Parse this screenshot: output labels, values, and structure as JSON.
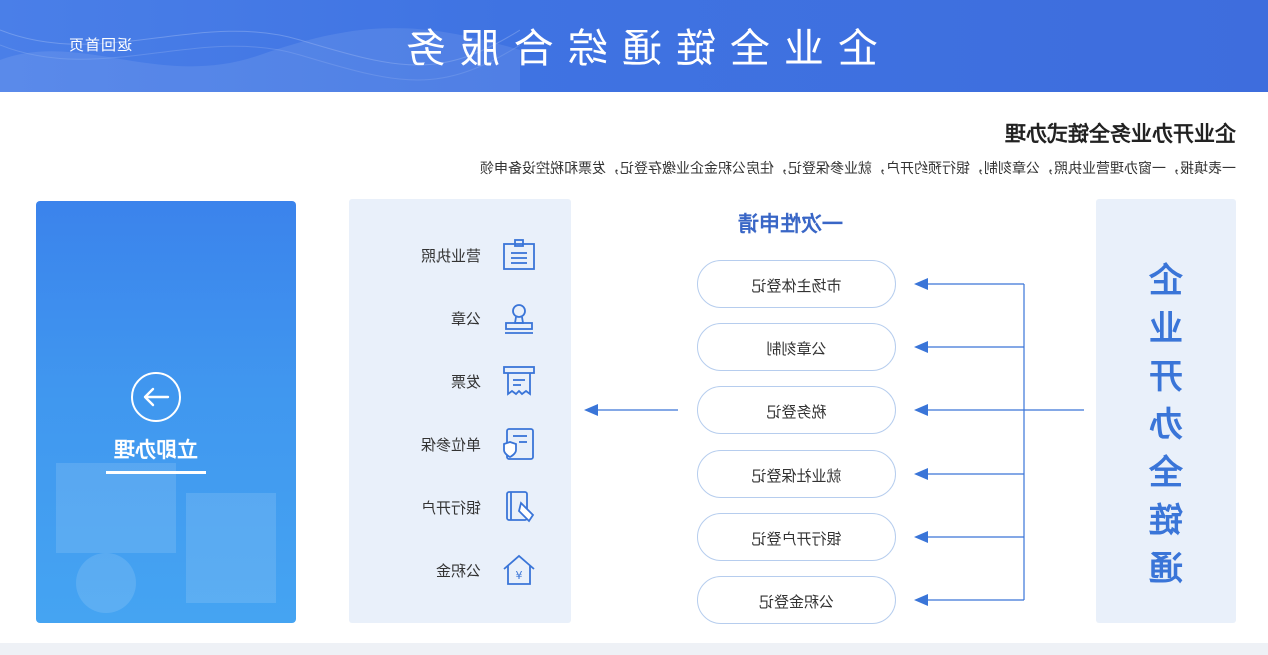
{
  "header": {
    "title": "企业全链通综合服务",
    "back_link": "返回首页"
  },
  "intro": {
    "heading": "企业开办业务全链式办理",
    "description": "一表填报，一窗办理营业执照，公章刻制，银行预约开户，就业参保登记，住房公积金企业缴存登记，发票和税控设备申领"
  },
  "action_card": {
    "label": "立即办理",
    "icon": "arrow-left-icon"
  },
  "materials": [
    {
      "label": "营业执照",
      "icon": "license-icon"
    },
    {
      "label": "公章",
      "icon": "seal-icon"
    },
    {
      "label": "发票",
      "icon": "invoice-icon"
    },
    {
      "label": "单位参保",
      "icon": "insurance-icon"
    },
    {
      "label": "银行开户",
      "icon": "bank-card-icon"
    },
    {
      "label": "公积金",
      "icon": "housing-fund-icon"
    }
  ],
  "apply": {
    "title": "一次性申请",
    "steps": [
      "市场主体登记",
      "公章刻制",
      "税务登记",
      "就业社保登记",
      "银行开户登记",
      "公积金登记"
    ]
  },
  "side_panel": {
    "chars": [
      "企",
      "业",
      "开",
      "办",
      "全",
      "链",
      "通"
    ]
  },
  "colors": {
    "banner": "#4178e3",
    "accent": "#3a75d8",
    "panel_bg": "#e9f0fa",
    "card_top": "#3b83ec",
    "card_bottom": "#45a4f2"
  }
}
